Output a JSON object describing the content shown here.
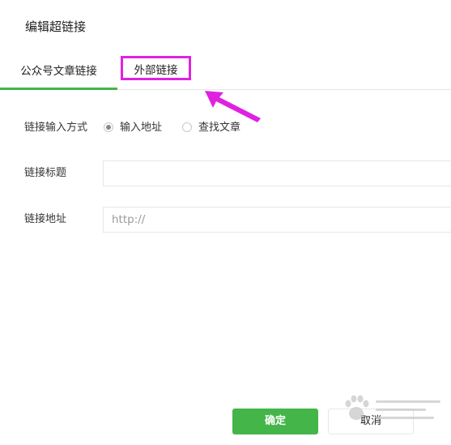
{
  "dialog": {
    "title": "编辑超链接"
  },
  "tabs": [
    {
      "label": "公众号文章链接",
      "active": true
    },
    {
      "label": "外部链接",
      "active": false,
      "highlighted": true
    }
  ],
  "form": {
    "input_method": {
      "label": "链接输入方式",
      "options": [
        {
          "label": "输入地址",
          "checked": true
        },
        {
          "label": "查找文章",
          "checked": false
        }
      ]
    },
    "link_title": {
      "label": "链接标题",
      "value": "",
      "placeholder": ""
    },
    "link_url": {
      "label": "链接地址",
      "value": "",
      "placeholder": "http://"
    }
  },
  "buttons": {
    "ok": "确定",
    "cancel": "取消"
  },
  "colors": {
    "accent": "#44b549",
    "highlight": "#e022e0",
    "border": "#e4e8eb"
  },
  "icons": {
    "annotation": "arrow-icon",
    "watermark": "paw-icon"
  }
}
